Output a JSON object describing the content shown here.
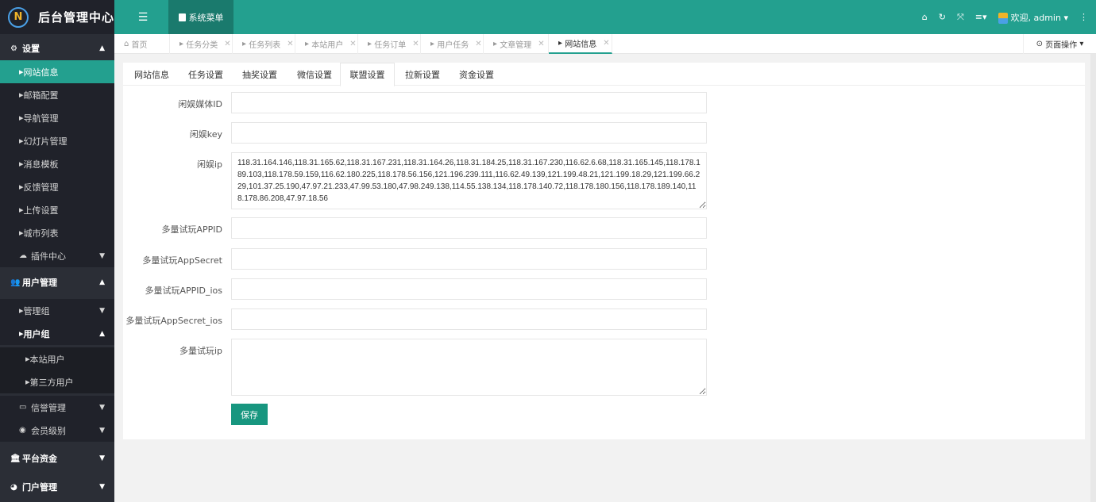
{
  "app": {
    "title": "后台管理中心",
    "logo_text": "N"
  },
  "topbar": {
    "system_menu": "系统菜单",
    "welcome": "欢迎, admin",
    "icons": [
      "menu-toggle-icon",
      "home-icon",
      "refresh-icon",
      "fullscreen-icon",
      "list-icon",
      "more-icon"
    ]
  },
  "sidebar": {
    "items": [
      {
        "label": "设置",
        "type": "group"
      },
      {
        "label": "网站信息",
        "type": "item",
        "active": true
      },
      {
        "label": "邮箱配置",
        "type": "item"
      },
      {
        "label": "导航管理",
        "type": "item"
      },
      {
        "label": "幻灯片管理",
        "type": "item"
      },
      {
        "label": "消息模板",
        "type": "item"
      },
      {
        "label": "反馈管理",
        "type": "item"
      },
      {
        "label": "上传设置",
        "type": "item"
      },
      {
        "label": "城市列表",
        "type": "item"
      },
      {
        "label": "插件中心",
        "type": "item"
      },
      {
        "label": "用户管理",
        "type": "group"
      },
      {
        "label": "管理组",
        "type": "item"
      },
      {
        "label": "用户组",
        "type": "item"
      },
      {
        "label": "本站用户",
        "type": "sub"
      },
      {
        "label": "第三方用户",
        "type": "sub"
      },
      {
        "label": "信誉管理",
        "type": "item"
      },
      {
        "label": "会员级别",
        "type": "item"
      },
      {
        "label": "平台资金",
        "type": "group"
      },
      {
        "label": "门户管理",
        "type": "group"
      }
    ]
  },
  "tabs": {
    "items": [
      "首页",
      "任务分类",
      "任务列表",
      "本站用户",
      "任务订单",
      "用户任务",
      "文章管理",
      "网站信息"
    ],
    "active": "网站信息",
    "page_ops": "页面操作"
  },
  "subtabs": {
    "items": [
      "网站信息",
      "任务设置",
      "抽奖设置",
      "微信设置",
      "联盟设置",
      "拉新设置",
      "资金设置"
    ],
    "active": "联盟设置"
  },
  "form": {
    "fields": [
      {
        "label": "闲娱媒体ID",
        "value": ""
      },
      {
        "label": "闲娱key",
        "value": ""
      },
      {
        "label": "闲娱ip",
        "value": "118.31.164.146,118.31.165.62,118.31.167.231,118.31.164.26,118.31.184.25,118.31.167.230,116.62.6.68,118.31.165.145,118.178.189.103,118.178.59.159,116.62.180.225,118.178.56.156,121.196.239.111,116.62.49.139,121.199.48.21,121.199.18.29,121.199.66.229,101.37.25.190,47.97.21.233,47.99.53.180,47.98.249.138,114.55.138.134,118.178.140.72,118.178.180.156,118.178.189.140,118.178.86.208,47.97.18.56"
      },
      {
        "label": "多量试玩APPID",
        "value": ""
      },
      {
        "label": "多量试玩AppSecret",
        "value": ""
      },
      {
        "label": "多量试玩APPID_ios",
        "value": ""
      },
      {
        "label": "多量试玩AppSecret_ios",
        "value": ""
      },
      {
        "label": "多量试玩ip",
        "value": ""
      }
    ],
    "save_label": "保存"
  },
  "colors": {
    "primary": "#23a08f",
    "sidebar_bg": "#2b2e36",
    "sidebar_item_bg": "#20222a"
  }
}
